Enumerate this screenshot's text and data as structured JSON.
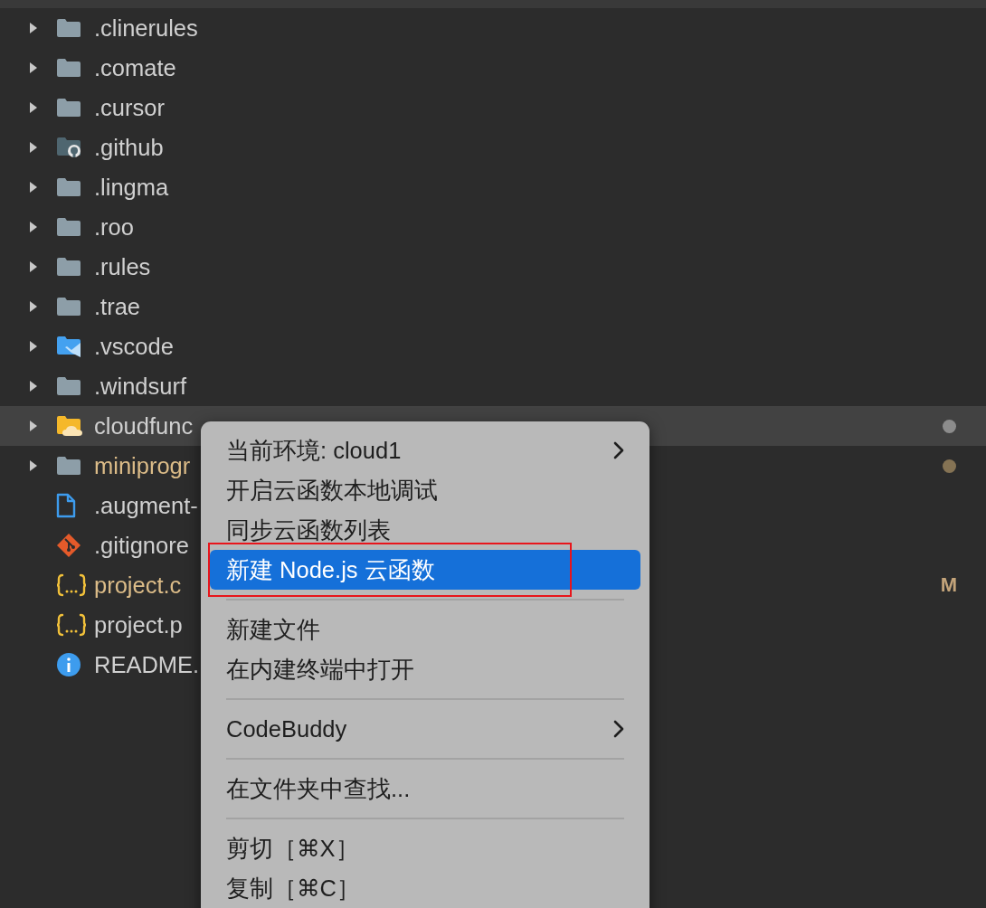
{
  "tree": [
    {
      "kind": "folder",
      "label": ".clinerules",
      "expanded": false,
      "selected": false,
      "modified": false
    },
    {
      "kind": "folder",
      "label": ".comate",
      "expanded": false,
      "selected": false,
      "modified": false
    },
    {
      "kind": "folder",
      "label": ".cursor",
      "expanded": false,
      "selected": false,
      "modified": false
    },
    {
      "kind": "github",
      "label": ".github",
      "expanded": false,
      "selected": false,
      "modified": false
    },
    {
      "kind": "folder",
      "label": ".lingma",
      "expanded": false,
      "selected": false,
      "modified": false
    },
    {
      "kind": "folder",
      "label": ".roo",
      "expanded": false,
      "selected": false,
      "modified": false
    },
    {
      "kind": "folder",
      "label": ".rules",
      "expanded": false,
      "selected": false,
      "modified": false
    },
    {
      "kind": "folder",
      "label": ".trae",
      "expanded": false,
      "selected": false,
      "modified": false
    },
    {
      "kind": "vscode",
      "label": ".vscode",
      "expanded": false,
      "selected": false,
      "modified": false
    },
    {
      "kind": "folder",
      "label": ".windsurf",
      "expanded": false,
      "selected": false,
      "modified": false
    },
    {
      "kind": "cloud",
      "label": "cloudfunc",
      "expanded": false,
      "selected": true,
      "modified": false,
      "decoration": {
        "kind": "dot",
        "color": "#8c8c8c"
      }
    },
    {
      "kind": "folder",
      "label": "miniprogr",
      "expanded": false,
      "selected": false,
      "modified": true,
      "decoration": {
        "kind": "dot",
        "color": "#857354"
      }
    },
    {
      "kind": "file",
      "label": ".augment-",
      "selected": false,
      "modified": false
    },
    {
      "kind": "git",
      "label": ".gitignore",
      "selected": false,
      "modified": false
    },
    {
      "kind": "json",
      "label": "project.c",
      "selected": false,
      "modified": true,
      "decoration": {
        "kind": "letter",
        "text": "M"
      }
    },
    {
      "kind": "json",
      "label": "project.p",
      "selected": false,
      "modified": false
    },
    {
      "kind": "info",
      "label": "README.",
      "selected": false,
      "modified": false
    }
  ],
  "context_menu": [
    {
      "kind": "item",
      "label": "当前环境: cloud1",
      "submenu": true,
      "selected": false,
      "annotated": false
    },
    {
      "kind": "item",
      "label": "开启云函数本地调试",
      "submenu": false,
      "selected": false,
      "annotated": false
    },
    {
      "kind": "item",
      "label": "同步云函数列表",
      "submenu": false,
      "selected": false,
      "annotated": false
    },
    {
      "kind": "item",
      "label": "新建 Node.js 云函数",
      "submenu": false,
      "selected": true,
      "annotated": true
    },
    {
      "kind": "separator"
    },
    {
      "kind": "item",
      "label": "新建文件",
      "submenu": false,
      "selected": false,
      "annotated": false
    },
    {
      "kind": "item",
      "label": "在内建终端中打开",
      "submenu": false,
      "selected": false,
      "annotated": false
    },
    {
      "kind": "separator"
    },
    {
      "kind": "item",
      "label": "CodeBuddy",
      "submenu": true,
      "selected": false,
      "annotated": false
    },
    {
      "kind": "separator"
    },
    {
      "kind": "item",
      "label": "在文件夹中查找...",
      "submenu": false,
      "selected": false,
      "annotated": false
    },
    {
      "kind": "separator"
    },
    {
      "kind": "item",
      "label": "剪切［⌘X］",
      "submenu": false,
      "selected": false,
      "annotated": false
    },
    {
      "kind": "item",
      "label": "复制［⌘C］",
      "submenu": false,
      "selected": false,
      "annotated": false
    }
  ]
}
